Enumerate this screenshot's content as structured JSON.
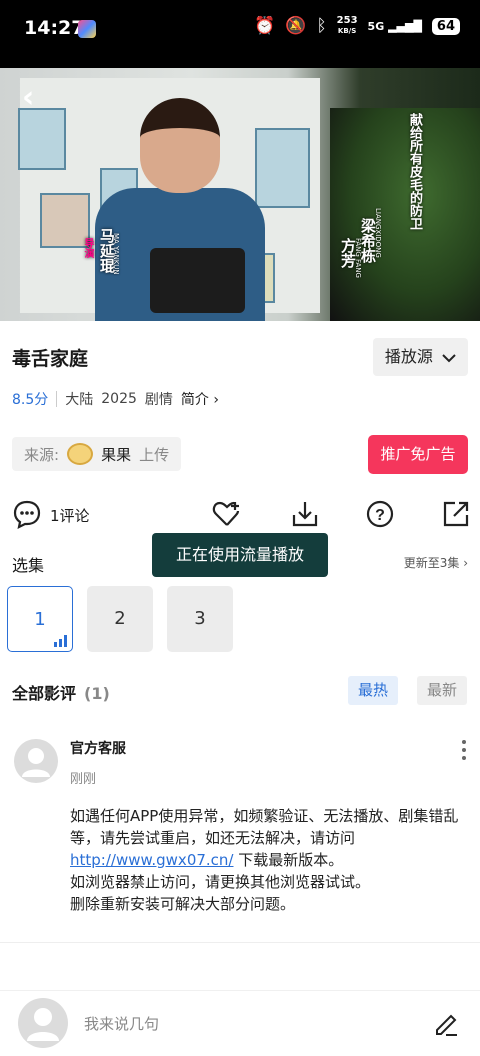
{
  "status_bar": {
    "time": "14:27",
    "net_speed_value": "253",
    "net_speed_unit": "KB/S",
    "network": "5G",
    "battery": "64",
    "icons": [
      "alarm-icon",
      "mute-icon",
      "bluetooth-icon",
      "signal-icon"
    ]
  },
  "video": {
    "caption_left_cn": "马延琨",
    "caption_left_en": "MA YANKUN",
    "caption_mid_cn": "方芳",
    "caption_mid_en": "FANG FANG",
    "caption_right_cn": "梁希栋",
    "caption_right_en": "LIANGXIDONG",
    "caption_tag": "导演",
    "side_text": "献给所有皮毛的防卫"
  },
  "show": {
    "title": "毒舌家庭",
    "source_button": "播放源",
    "score": "8.5分",
    "region": "大陆",
    "year": "2025",
    "genre": "剧情",
    "intro": "简介",
    "uploader_label": "来源:",
    "uploader_name": "果果",
    "uploader_suffix": "上传",
    "promo_button": "推广免广告"
  },
  "actions": {
    "comment_count": "1评论"
  },
  "toast": "正在使用流量播放",
  "episodes": {
    "label": "选集",
    "update_info": "更新至3集",
    "items": [
      "1",
      "2",
      "3"
    ]
  },
  "reviews": {
    "title": "全部影评",
    "count": "(1)",
    "tab_hot": "最热",
    "tab_new": "最新",
    "items": [
      {
        "author": "官方客服",
        "time": "刚刚",
        "line1": "如遇任何APP使用异常，如频繁验证、无法播放、剧集错乱等，请先尝试重启，如还无法解决，请访问",
        "link": "http://www.gwx07.cn/",
        "line2": "下载最新版本。",
        "line3": "如浏览器禁止访问，请更换其他浏览器试试。",
        "line4": "删除重新安装可解决大部分问题。"
      }
    ]
  },
  "composer": {
    "placeholder": "我来说几句"
  },
  "colors": {
    "accent": "#2a6fd6",
    "promo": "#f5365c",
    "toast_bg": "#143d3c"
  }
}
